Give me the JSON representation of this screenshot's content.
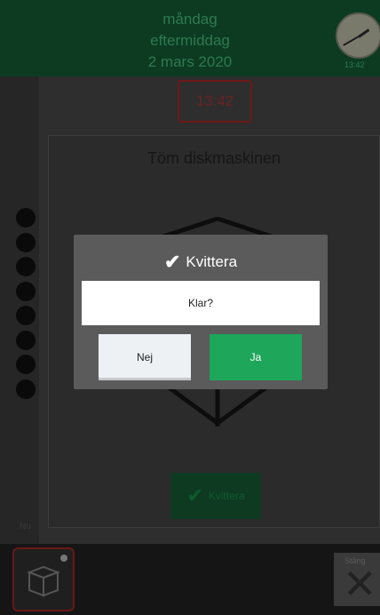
{
  "header": {
    "day": "måndag",
    "period": "eftermiddag",
    "date": "2 mars 2020",
    "clock_label": "13:42"
  },
  "current_time": "13:42",
  "task": {
    "title": "Töm diskmaskinen",
    "progress_dots": 8,
    "acknowledge_label": "Kvittera"
  },
  "now_label": "Nu",
  "footer": {
    "close_label": "Stäng"
  },
  "dialog": {
    "title": "Kvittera",
    "question": "Klar?",
    "no_label": "Nej",
    "yes_label": "Ja"
  },
  "colors": {
    "header_bg": "#0c3b22",
    "accent_green": "#1ea65a",
    "time_border": "#6e1818"
  },
  "icons": {
    "dialog_check": "check-icon",
    "task_image": "dishwasher-box-icon",
    "footer_app": "dishwasher-icon",
    "footer_close": "close-icon"
  }
}
